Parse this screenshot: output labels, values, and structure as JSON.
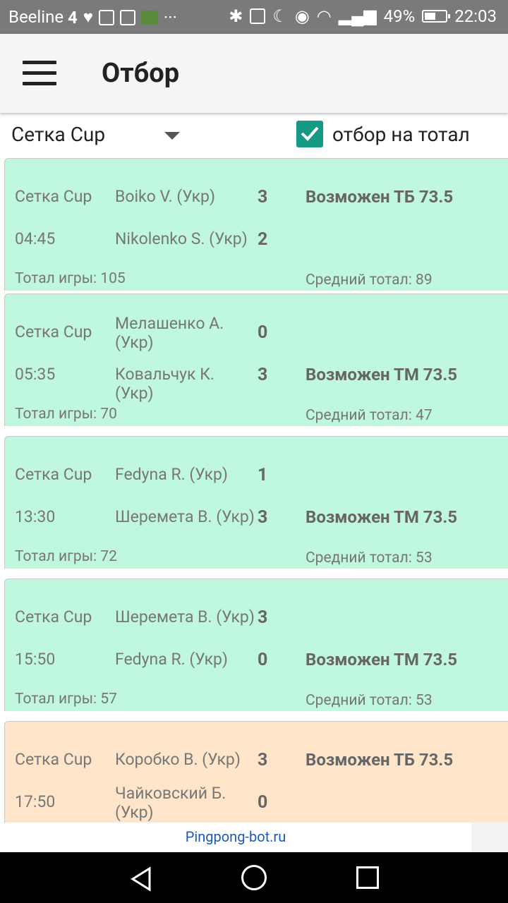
{
  "status_bar": {
    "carrier": "Beeline",
    "network": "4",
    "battery": "49%",
    "time": "22:03"
  },
  "app_bar": {
    "title": "Отбор"
  },
  "filter": {
    "league": "Сетка Cup",
    "checkbox_label": "отбор на тотал",
    "checked": true
  },
  "matches": [
    {
      "league": "Сетка Cup",
      "time": "04:45",
      "player1": "Boiko V. (Укр)",
      "player2": "Nikolenko S. (Укр)",
      "score1": "3",
      "score2": "2",
      "prediction": "Возможен ТБ 73.5",
      "prediction_row": 1,
      "total": "Тотал игры: 105",
      "avg": "Средний тотал: 89",
      "color": "#bff7df"
    },
    {
      "league": "Сетка Cup",
      "time": "05:35",
      "player1": "Мелашенко А. (Укр)",
      "player2": "Ковальчук К. (Укр)",
      "score1": "0",
      "score2": "3",
      "prediction": "Возможен ТМ 73.5",
      "prediction_row": 2,
      "total": "Тотал игры: 70",
      "avg": "Средний тотал: 47",
      "color": "#bff7df"
    },
    {
      "league": "Сетка Cup",
      "time": "13:30",
      "player1": "Fedyna R. (Укр)",
      "player2": "Шеремета В. (Укр)",
      "score1": "1",
      "score2": "3",
      "prediction": "Возможен ТМ 73.5",
      "prediction_row": 2,
      "total": "Тотал игры: 72",
      "avg": "Средний тотал: 53",
      "color": "#bff7df"
    },
    {
      "league": "Сетка Cup",
      "time": "15:50",
      "player1": "Шеремета В. (Укр)",
      "player2": "Fedyna R. (Укр)",
      "score1": "3",
      "score2": "0",
      "prediction": "Возможен ТМ 73.5",
      "prediction_row": 2,
      "total": "Тотал игры: 57",
      "avg": "Средний тотал: 53",
      "color": "#bff7df"
    },
    {
      "league": "Сетка Cup",
      "time": "17:50",
      "player1": "Коробко В. (Укр)",
      "player2": "Чайковский Б. (Укр)",
      "score1": "3",
      "score2": "0",
      "prediction": "Возможен ТБ 73.5",
      "prediction_row": 1,
      "total": "",
      "avg": "",
      "color": "#ffe5c9"
    }
  ],
  "footer": {
    "link": "Pingpong-bot.ru"
  }
}
